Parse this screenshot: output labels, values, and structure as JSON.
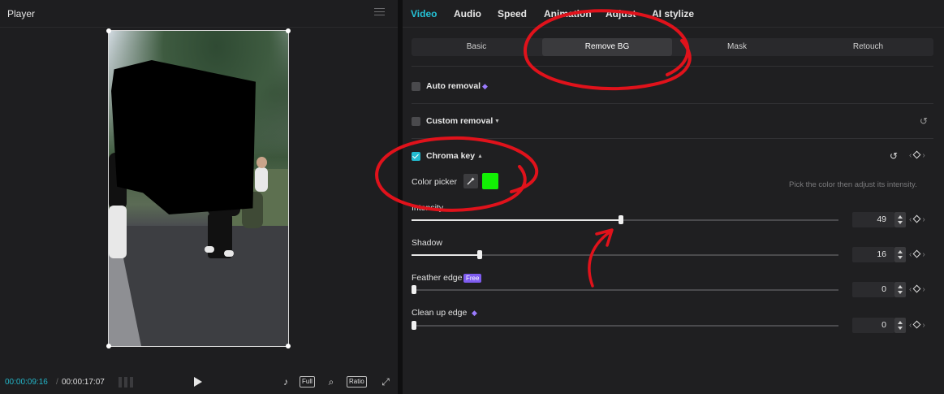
{
  "player": {
    "title": "Player",
    "timecode_current": "00:00:09:16",
    "timecode_separator": "/",
    "timecode_total": "00:00:17:07",
    "controls": {
      "full": "Full",
      "ratio": "Ratio"
    }
  },
  "tabs": [
    "Video",
    "Audio",
    "Speed",
    "Animation",
    "Adjust",
    "AI stylize"
  ],
  "active_tab": "Video",
  "subtabs": [
    "Basic",
    "Remove BG",
    "Mask",
    "Retouch"
  ],
  "active_subtab": "Remove BG",
  "options": {
    "auto_removal": {
      "label": "Auto removal",
      "checked": false
    },
    "custom_removal": {
      "label": "Custom removal",
      "checked": false
    },
    "chroma_key": {
      "label": "Chroma key",
      "checked": true
    }
  },
  "color_picker": {
    "label": "Color picker",
    "color": "#12f004",
    "hint": "Pick the color then adjust its intensity."
  },
  "sliders": [
    {
      "label": "Intensity",
      "value": "49",
      "fraction": 0.49
    },
    {
      "label": "Shadow",
      "value": "16",
      "fraction": 0.16
    },
    {
      "label": "Feather edge",
      "value": "0",
      "fraction": 0.0,
      "badge": "Free"
    },
    {
      "label": "Clean up edge",
      "value": "0",
      "fraction": 0.0
    }
  ],
  "colors": {
    "accent": "#25c2d6",
    "annotation": "#e0121b",
    "pro_gem": "#9b7bff"
  }
}
